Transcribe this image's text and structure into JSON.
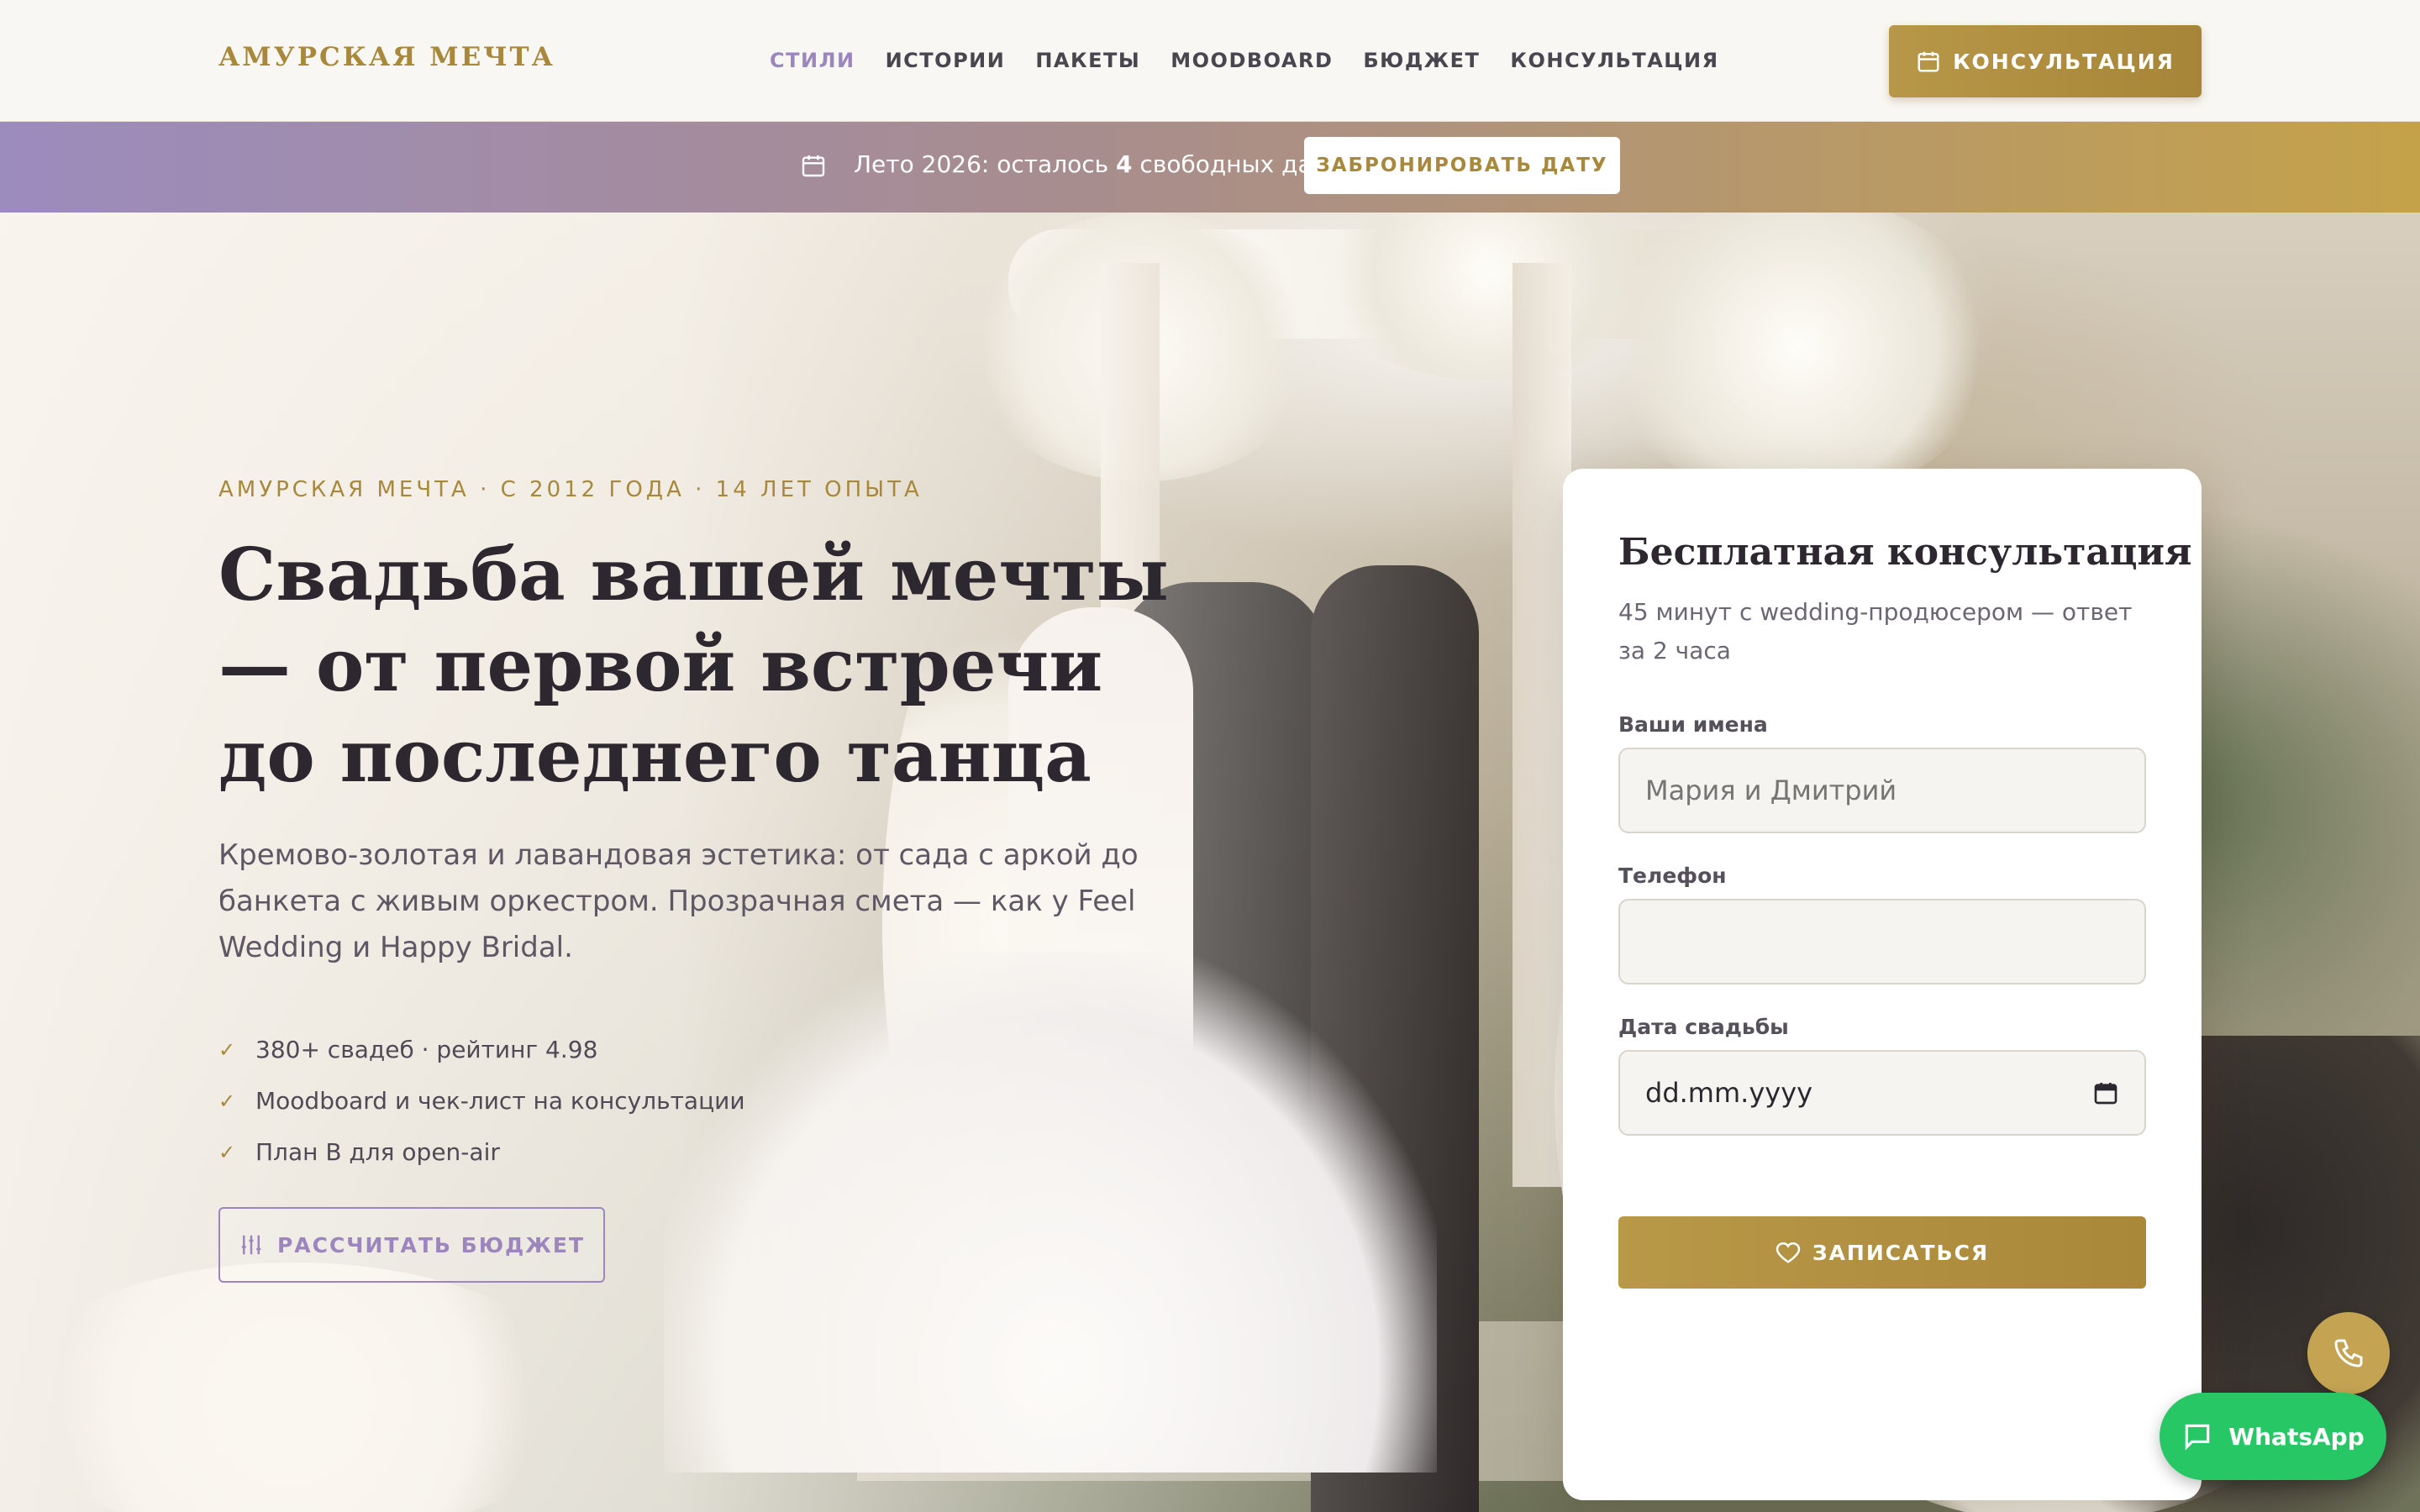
{
  "header": {
    "logo": "АМУРСКАЯ МЕЧТА",
    "nav": [
      {
        "label": "СТИЛИ",
        "active": true
      },
      {
        "label": "ИСТОРИИ",
        "active": false
      },
      {
        "label": "ПАКЕТЫ",
        "active": false
      },
      {
        "label": "MOODBOARD",
        "active": false
      },
      {
        "label": "БЮДЖЕТ",
        "active": false
      },
      {
        "label": "КОНСУЛЬТАЦИЯ",
        "active": false
      }
    ],
    "cta_label": "КОНСУЛЬТАЦИЯ"
  },
  "promo": {
    "text_before": "Лето 2026: осталось ",
    "count": "4",
    "text_after": " свободных дат",
    "button_label": "ЗАБРОНИРОВАТЬ ДАТУ"
  },
  "hero": {
    "eyebrow": "АМУРСКАЯ МЕЧТА · С 2012 ГОДА · 14 ЛЕТ ОПЫТА",
    "title": "Свадьба вашей мечты — от первой встречи до последнего танца",
    "lead": "Кремово-золотая и лавандовая эстетика: от сада с аркой до банкета с живым оркестром. Прозрачная смета — как у Feel Wedding и Happy Bridal.",
    "checks": [
      "380+ свадеб · рейтинг 4.98",
      "Moodboard и чек-лист на консультации",
      "План B для open-air"
    ],
    "budget_button": "РАССЧИТАТЬ БЮДЖЕТ"
  },
  "form": {
    "title": "Бесплатная консультация",
    "subtitle": "45 минут с wedding-продюсером — ответ за 2 часа",
    "names_label": "Ваши имена",
    "names_placeholder": "Мария и Дмитрий",
    "phone_label": "Телефон",
    "phone_value": "",
    "date_label": "Дата свадьбы",
    "date_placeholder": "dd.mm.yyyy",
    "submit_label": "ЗАПИСАТЬСЯ"
  },
  "floating": {
    "whatsapp_label": "WhatsApp"
  },
  "colors": {
    "gold": "#a8893c",
    "lavender": "#9c86bd",
    "whatsapp": "#27c766"
  }
}
